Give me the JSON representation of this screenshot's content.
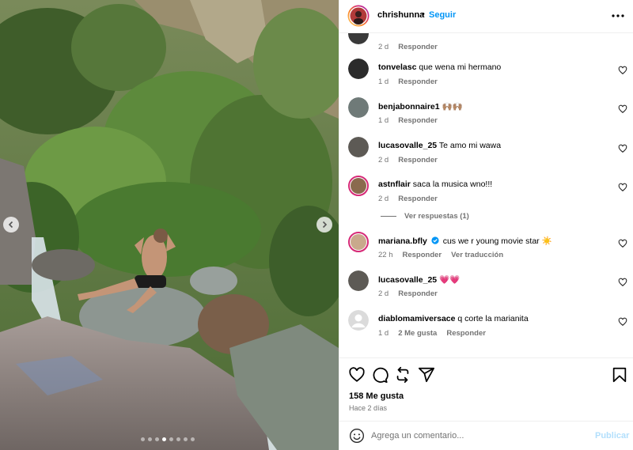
{
  "header": {
    "username": "chrishunna",
    "separator": "•",
    "follow_label": "Seguir",
    "more_icon": "more-horizontal-icon"
  },
  "comments": [
    {
      "username": "",
      "text": "",
      "time": "2 d",
      "likes_label": "",
      "reply_label": "Responder",
      "avatar_color": "#3a3a3a"
    },
    {
      "username": "tonvelasc",
      "text": "que wena mi hermano",
      "time": "1 d",
      "likes_label": "",
      "reply_label": "Responder",
      "avatar_color": "#2b2b2b"
    },
    {
      "username": "benjabonnaire1",
      "text": "🙌🏽🙌🏽",
      "time": "1 d",
      "likes_label": "",
      "reply_label": "Responder",
      "avatar_color": "#6f7a78"
    },
    {
      "username": "lucasovalle_25",
      "text": "Te amo mi wawa",
      "time": "2 d",
      "likes_label": "",
      "reply_label": "Responder",
      "avatar_color": "#5d5a55"
    },
    {
      "username": "astnflair",
      "text": "saca la musica wno!!!",
      "time": "2 d",
      "likes_label": "",
      "reply_label": "Responder",
      "avatar_color": "#8a6a4e"
    },
    {
      "username": "mariana.bfly",
      "text": "cus we r young movie star ☀️",
      "time": "22 h",
      "likes_label": "",
      "reply_label": "Responder",
      "translate_label": "Ver traducción",
      "avatar_color": "#c9a98c"
    },
    {
      "username": "lucasovalle_25",
      "text": "💗💗",
      "time": "2 d",
      "likes_label": "",
      "reply_label": "Responder",
      "avatar_color": "#5d5a55"
    },
    {
      "username": "diablomamiversace",
      "text": "q corte la marianita",
      "time": "1 d",
      "likes_label": "2 Me gusta",
      "reply_label": "Responder",
      "avatar_color": "#dbdbdb"
    }
  ],
  "view_replies_label": "Ver respuestas (1)",
  "actions": {
    "like_icon": "heart-icon",
    "comment_icon": "comment-icon",
    "repost_icon": "repost-icon",
    "share_icon": "send-icon",
    "save_icon": "bookmark-icon"
  },
  "likes_label": "158 Me gusta",
  "post_time": "Hace 2 días",
  "add_comment": {
    "placeholder": "Agrega un comentario...",
    "publish_label": "Publicar"
  },
  "carousel": {
    "total_slides": 8,
    "active_slide": 4
  },
  "colors": {
    "accent": "#0095f6",
    "publish_disabled": "#b2dffc",
    "muted": "#737373",
    "verified": "#0095f6",
    "heart": "#e8305a"
  }
}
